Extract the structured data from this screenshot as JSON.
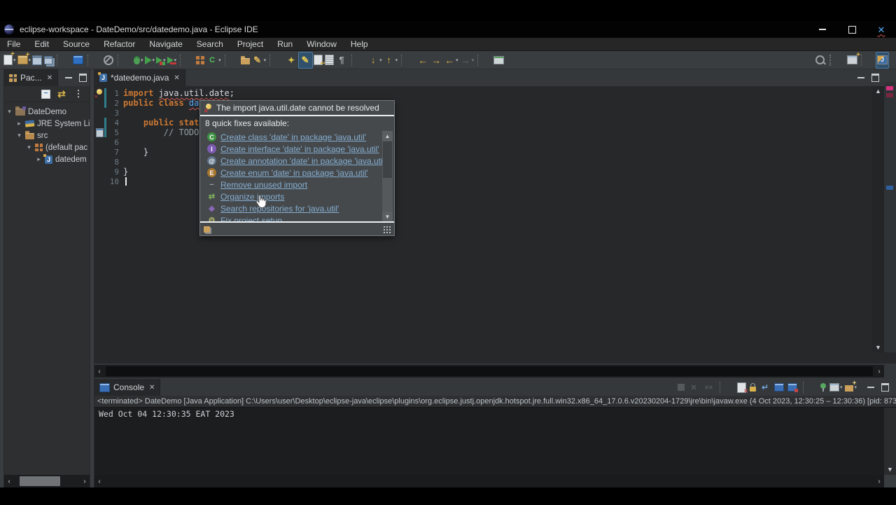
{
  "titlebar": {
    "title": "eclipse-workspace - DateDemo/src/datedemo.java - Eclipse IDE"
  },
  "menubar": {
    "items": [
      "File",
      "Edit",
      "Source",
      "Refactor",
      "Navigate",
      "Search",
      "Project",
      "Run",
      "Window",
      "Help"
    ]
  },
  "toolbar": {
    "items": [
      {
        "kind": "k-icon",
        "name": "new-button",
        "shape": "s-doc-new",
        "drop": true
      },
      {
        "kind": "k-icon",
        "name": "new-java-project-button",
        "shape": "s-win-new",
        "drop": true
      },
      {
        "kind": "k-icon",
        "name": "save-button",
        "shape": "s-floppy"
      },
      {
        "kind": "k-icon",
        "name": "save-all-button",
        "shape": "s-floppy-all"
      },
      {
        "kind": "k-sep"
      },
      {
        "kind": "k-icon",
        "name": "open-task-button",
        "shape": "s-blue-win"
      },
      {
        "kind": "k-sep"
      },
      {
        "kind": "k-icon",
        "name": "skip-all-breakpoints-button",
        "shape": "s-circle-slash"
      },
      {
        "kind": "k-sep"
      },
      {
        "kind": "k-icon",
        "name": "debug-button",
        "shape": "s-bug",
        "drop": true
      },
      {
        "kind": "k-icon",
        "name": "run-button",
        "shape": "s-run",
        "drop": true
      },
      {
        "kind": "k-icon",
        "name": "coverage-button",
        "shape": "s-run-cov",
        "drop": true
      },
      {
        "kind": "k-icon",
        "name": "profile-button",
        "shape": "s-run-prof",
        "drop": true
      },
      {
        "kind": "k-sep"
      },
      {
        "kind": "k-icon",
        "name": "new-java-class-button",
        "shape": "s-grid-orange"
      },
      {
        "kind": "k-icon",
        "name": "new-class-wizard-button",
        "shape": "s-c-plus",
        "drop": true
      },
      {
        "kind": "k-sep"
      },
      {
        "kind": "k-icon",
        "name": "import-button",
        "shape": "s-folder-open"
      },
      {
        "kind": "k-icon",
        "name": "format-button",
        "shape": "s-brush",
        "drop": true
      },
      {
        "kind": "k-sep"
      },
      {
        "kind": "k-icon",
        "name": "open-type-button",
        "shape": "s-flash"
      },
      {
        "kind": "k-icon",
        "name": "mark-occurrences-button",
        "shape": "s-pencil",
        "sel": true
      },
      {
        "kind": "k-icon",
        "name": "link-with-editor-button",
        "shape": "s-doc-arrow"
      },
      {
        "kind": "k-icon",
        "name": "show-selected-element-button",
        "shape": "s-doc-lines"
      },
      {
        "kind": "k-icon",
        "name": "show-whitespace-button",
        "shape": "s-para"
      },
      {
        "kind": "k-sep"
      },
      {
        "kind": "k-icon",
        "name": "next-annotation-button",
        "shape": "s-down-lines",
        "drop": true
      },
      {
        "kind": "k-icon",
        "name": "previous-annotation-button",
        "shape": "s-up-lines",
        "drop": true
      },
      {
        "kind": "k-sep"
      },
      {
        "kind": "k-icon",
        "name": "last-edit-location-button",
        "shape": "s-arrow-left"
      },
      {
        "kind": "k-icon",
        "name": "next-edit-location-button",
        "shape": "s-arrow-rightc"
      },
      {
        "kind": "k-icon",
        "name": "back-button",
        "shape": "s-arrow-left2",
        "drop": true
      },
      {
        "kind": "k-icon",
        "name": "forward-button",
        "shape": "s-arrow-right2",
        "drop": true,
        "dis": true
      },
      {
        "kind": "k-sep"
      },
      {
        "kind": "k-icon",
        "name": "new-editor-window-button",
        "shape": "s-new-win"
      }
    ],
    "right": [
      {
        "kind": "k-icon",
        "name": "search-button",
        "shape": "s-mag"
      },
      {
        "kind": "k-dots"
      },
      {
        "kind": "k-icon",
        "name": "open-perspective-button",
        "shape": "s-persp-new"
      },
      {
        "kind": "k-sep"
      },
      {
        "kind": "k-icon",
        "name": "java-perspective-button",
        "shape": "s-persp-java",
        "sel": true
      }
    ]
  },
  "sidebar": {
    "tab_label": "Pac...",
    "tree": [
      {
        "name": "tree-item-datedemo-project",
        "chev": "▾",
        "icon": "t-project",
        "label": "DateDemo",
        "lv": "lv0"
      },
      {
        "name": "tree-item-jre-system-library",
        "chev": "▸",
        "icon": "t-library",
        "label": "JRE System Lib",
        "lv": "lv1"
      },
      {
        "name": "tree-item-src",
        "chev": "▾",
        "icon": "t-src",
        "label": "src",
        "lv": "lv1"
      },
      {
        "name": "tree-item-default-package",
        "chev": "▾",
        "icon": "t-package",
        "label": "(default pac",
        "lv": "lv2"
      },
      {
        "name": "tree-item-datedemo-file",
        "chev": "▸",
        "icon": "s-jfile",
        "label": "datedem",
        "lv": "lv3"
      }
    ]
  },
  "editor": {
    "tab_label": "*datedemo.java",
    "lines": [
      {
        "num": "1",
        "marker": "bulbx",
        "diff": "on",
        "segs": [
          {
            "cls": "kw",
            "text": "import "
          },
          {
            "cls": "err",
            "text": "java.util.date"
          },
          {
            "cls": "pln",
            "text": ";"
          }
        ]
      },
      {
        "num": "2",
        "diff": "on",
        "segs": [
          {
            "cls": "kw",
            "text": "public class "
          },
          {
            "cls": "cls",
            "text": "date"
          }
        ]
      },
      {
        "num": "3",
        "segs": []
      },
      {
        "num": "4",
        "diff": "on",
        "fold": "fold-on",
        "segs": [
          {
            "cls": "pln",
            "text": "    "
          },
          {
            "cls": "kw",
            "text": "public static"
          }
        ]
      },
      {
        "num": "5",
        "marker": "taskic",
        "diff": "on",
        "segs": [
          {
            "cls": "pln",
            "text": "        "
          },
          {
            "cls": "cmt",
            "text": "// TODO A"
          }
        ]
      },
      {
        "num": "6",
        "segs": []
      },
      {
        "num": "7",
        "segs": [
          {
            "cls": "pln",
            "text": "    }"
          }
        ]
      },
      {
        "num": "8",
        "segs": []
      },
      {
        "num": "9",
        "segs": [
          {
            "cls": "pln",
            "text": "}"
          }
        ]
      },
      {
        "num": "10",
        "caret": "on",
        "segs": []
      }
    ]
  },
  "quickfix": {
    "title": "The import java.util.date cannot be resolved",
    "subtitle": "8 quick fixes available:",
    "items": [
      {
        "name": "fix-create-class",
        "letter": "C",
        "bg": "#3f9144",
        "round": true,
        "label": "Create class 'date' in package 'java.util'"
      },
      {
        "name": "fix-create-interface",
        "letter": "I",
        "bg": "#7d5bb5",
        "round": true,
        "label": "Create interface 'date' in package 'java.util'"
      },
      {
        "name": "fix-create-annotation",
        "letter": "@",
        "bg": "#5f7288",
        "round": true,
        "label": "Create annotation 'date' in package 'java.util'"
      },
      {
        "name": "fix-create-enum",
        "letter": "E",
        "bg": "#a8762e",
        "round": true,
        "label": "Create enum 'date' in package 'java.util'"
      },
      {
        "name": "fix-remove-unused-import",
        "letter": "−",
        "fg": "#9aa5ab",
        "label": "Remove unused import"
      },
      {
        "name": "fix-organize-imports",
        "letter": "⇄",
        "fg": "#7fae5a",
        "label": "Organize imports"
      },
      {
        "name": "fix-search-repositories",
        "letter": "◈",
        "fg": "#8e6bbf",
        "label": "Search repositories for 'java.util'"
      },
      {
        "name": "fix-project-setup",
        "letter": "⚙",
        "fg": "#b0b56a",
        "label": "Fix project setup..."
      }
    ]
  },
  "console": {
    "tab_label": "Console",
    "status_line": "<terminated> DateDemo [Java Application] C:\\Users\\user\\Desktop\\eclipse-java\\eclipse\\plugins\\org.eclipse.justj.openjdk.hotspot.jre.full.win32.x86_64_17.0.6.v20230204-1729\\jre\\bin\\javaw.exe  (4 Oct 2023, 12:30:25 – 12:30:36) [pid: 873",
    "output_line": "Wed Oct 04 12:30:35 EAT 2023",
    "toolbar": [
      {
        "kind": "k-icon",
        "name": "terminate-button",
        "shape": "s-stop",
        "dis": true
      },
      {
        "kind": "k-icon",
        "name": "remove-launch-button",
        "shape": "s-xgrey",
        "dis": true
      },
      {
        "kind": "k-icon",
        "name": "remove-all-launches-button",
        "shape": "s-xxgrey",
        "dis": true
      },
      {
        "kind": "k-sep"
      },
      {
        "kind": "k-icon",
        "name": "clear-console-button",
        "shape": "s-doc-clear"
      },
      {
        "kind": "k-icon",
        "name": "scroll-lock-button",
        "shape": "s-lock"
      },
      {
        "kind": "k-icon",
        "name": "word-wrap-button",
        "shape": "s-wrap"
      },
      {
        "kind": "k-icon",
        "name": "show-stdout-button",
        "shape": "s-doc-chat"
      },
      {
        "kind": "k-icon",
        "name": "show-stderr-button",
        "shape": "s-doc-chat-red"
      },
      {
        "kind": "k-sep"
      },
      {
        "kind": "k-icon",
        "name": "pin-console-button",
        "shape": "s-pin"
      },
      {
        "kind": "k-icon",
        "name": "display-console-button",
        "shape": "s-display",
        "drop": true
      },
      {
        "kind": "k-icon",
        "name": "open-console-button",
        "shape": "s-new-console",
        "drop": true
      }
    ]
  }
}
